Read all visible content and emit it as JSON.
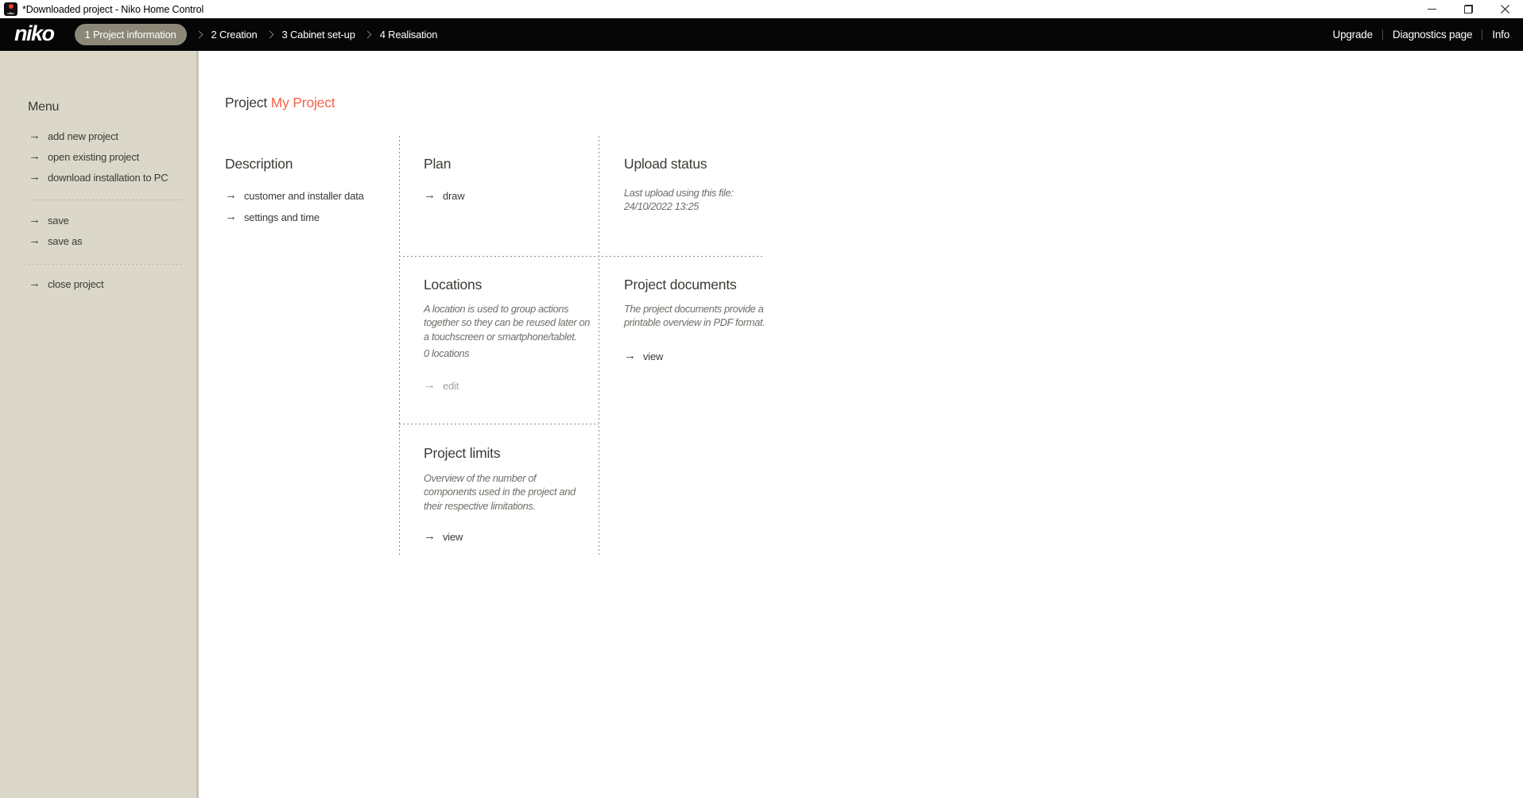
{
  "window": {
    "title": "*Downloaded project - Niko Home Control"
  },
  "icons": {
    "arrow_right": "→",
    "app_icon_text": "niko"
  },
  "navbar": {
    "logo": "niko",
    "steps": [
      {
        "label": "1 Project information",
        "active": true
      },
      {
        "label": "2 Creation",
        "active": false
      },
      {
        "label": "3 Cabinet set-up",
        "active": false
      },
      {
        "label": "4 Realisation",
        "active": false
      }
    ],
    "right_items": [
      "Upgrade",
      "Diagnostics page",
      "Info"
    ]
  },
  "sidebar": {
    "heading": "Menu",
    "groups": [
      {
        "items": [
          "add new project",
          "open existing project",
          "download installation to PC"
        ]
      },
      {
        "items": [
          "save",
          "save as"
        ]
      },
      {
        "items": [
          "close project"
        ]
      }
    ]
  },
  "main": {
    "title_prefix": "Project",
    "title_name": "My Project",
    "cards": {
      "description": {
        "heading": "Description",
        "links": [
          "customer and installer data",
          "settings and time"
        ]
      },
      "plan": {
        "heading": "Plan",
        "link": "draw"
      },
      "upload_status": {
        "heading": "Upload status",
        "body": [
          "Last upload using this file:",
          "24/10/2022 13:25"
        ]
      },
      "locations": {
        "heading": "Locations",
        "body": [
          "A location is used to group actions",
          "together so they can be reused later on",
          "a touchscreen or smartphone/tablet."
        ],
        "count": "0 locations",
        "link": "edit"
      },
      "project_documents": {
        "heading": "Project documents",
        "body": [
          "The project documents provide a",
          "printable overview in PDF format."
        ],
        "link": "view"
      },
      "project_limits": {
        "heading": "Project limits",
        "body": [
          "Overview of the number of",
          "components used in the project and",
          "their respective limitations."
        ],
        "link": "view"
      }
    }
  },
  "colors": {
    "accent_orange": "#F4624A",
    "nav_bg": "#060606",
    "pill_bg": "#8C8878",
    "sidebar_bg": "#DBD8CA"
  }
}
